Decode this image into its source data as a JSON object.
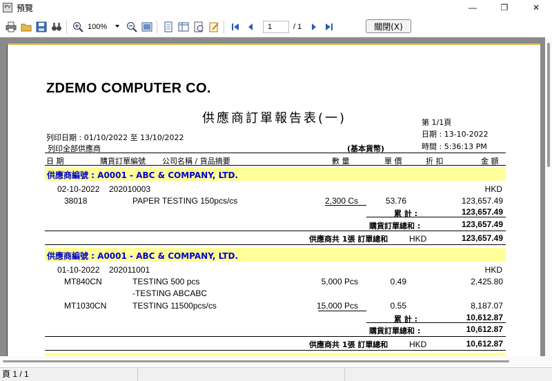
{
  "window": {
    "icon_text": "PV",
    "title": "預覽",
    "minimize": "—",
    "maximize": "❐",
    "close": "✕"
  },
  "toolbar": {
    "zoom": "100%",
    "page_current": "1",
    "page_total": "/ 1",
    "close_label": "關閉(X)"
  },
  "report": {
    "company": "ZDEMO COMPUTER CO.",
    "title": "供應商訂單報告表(一)",
    "page_info": "第 1/1頁",
    "date_info": "日期 : 13-10-2022",
    "time_info": "時間 : 5:36:13 PM",
    "print_date": "列印日期 : 01/10/2022 至 13/10/2022",
    "print_scope": "列印全部供應商",
    "base_currency": "(基本貨幣)",
    "columns": {
      "date": "日 期",
      "order_no": "購貨訂單編號",
      "company_desc": "公司名稱 / 貨品摘要",
      "qty": "數 量",
      "price": "單 價",
      "discount": "折 扣",
      "amount": "金 額"
    },
    "groups": [
      {
        "header": "供應商編號 : A0001 - ABC & COMPANY, LTD.",
        "order_date": "02-10-2022",
        "order_no": "202010003",
        "currency": "HKD",
        "lines": [
          {
            "code": "38018",
            "desc": "PAPER TESTING 150pcs/cs",
            "qty": "2,300 Cs",
            "price": "53.76",
            "amount": "123,657.49"
          }
        ],
        "subtotal_label": "累 計 :",
        "subtotal": "123,657.49",
        "order_total_label": "購貨訂單總和 :",
        "order_total": "123,657.49",
        "supplier_total_label": "供應商共 1張 訂單總和",
        "supplier_currency": "HKD",
        "supplier_total": "123,657.49"
      },
      {
        "header": "供應商編號 : A0001 - ABC & COMPANY, LTD.",
        "order_date": "01-10-2022",
        "order_no": "202011001",
        "currency": "HKD",
        "lines": [
          {
            "code": "MT840CN",
            "desc": "TESTING 500 pcs",
            "qty": "5,000 Pcs",
            "price": "0.49",
            "amount": "2,425.80"
          },
          {
            "code": "",
            "desc": "-TESTING ABCABC",
            "qty": "",
            "price": "",
            "amount": ""
          },
          {
            "code": "MT1030CN",
            "desc": "TESTING 11500pcs/cs",
            "qty": "15,000 Pcs",
            "price": "0.55",
            "amount": "8,187.07"
          }
        ],
        "subtotal_label": "累 計 :",
        "subtotal": "10,612.87",
        "order_total_label": "購貨訂單總和 :",
        "order_total": "10,612.87",
        "supplier_total_label": "供應商共 1張 訂單總和",
        "supplier_currency": "HKD",
        "supplier_total": "10,612.87"
      }
    ]
  },
  "status": {
    "page": "頁 1 / 1"
  }
}
